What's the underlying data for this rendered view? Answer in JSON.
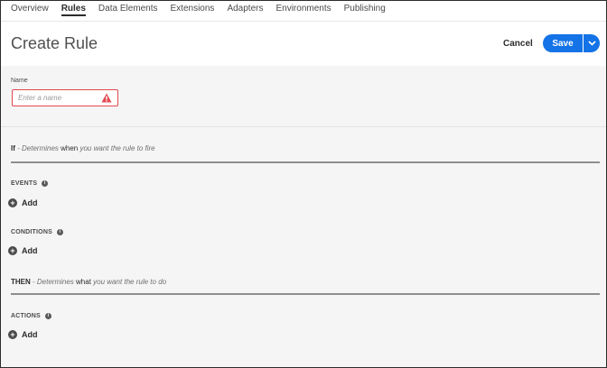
{
  "nav": {
    "tabs": [
      {
        "label": "Overview"
      },
      {
        "label": "Rules"
      },
      {
        "label": "Data Elements"
      },
      {
        "label": "Extensions"
      },
      {
        "label": "Adapters"
      },
      {
        "label": "Environments"
      },
      {
        "label": "Publishing"
      }
    ],
    "active": "Rules"
  },
  "header": {
    "title": "Create Rule",
    "cancel_label": "Cancel",
    "save_label": "Save"
  },
  "form": {
    "name_label": "Name",
    "name_placeholder": "Enter a name",
    "name_value": ""
  },
  "if_section": {
    "keyword": "If",
    "text_pre": " - Determines ",
    "text_em": "when",
    "text_post": " you want the rule to fire"
  },
  "events": {
    "label": "EVENTS",
    "add_label": "Add"
  },
  "conditions": {
    "label": "CONDITIONS",
    "add_label": "Add"
  },
  "then_section": {
    "keyword": "THEN",
    "text_pre": " - Determines ",
    "text_em": "what",
    "text_post": " you want the rule to do"
  },
  "actions": {
    "label": "ACTIONS",
    "add_label": "Add"
  },
  "colors": {
    "accent": "#1473e6",
    "error": "#e34850",
    "background": "#f5f5f5"
  },
  "icons": {
    "warning": "alert-triangle-icon",
    "info": "info-icon",
    "add": "add-circle-icon",
    "dropdown": "chevron-down-icon"
  }
}
